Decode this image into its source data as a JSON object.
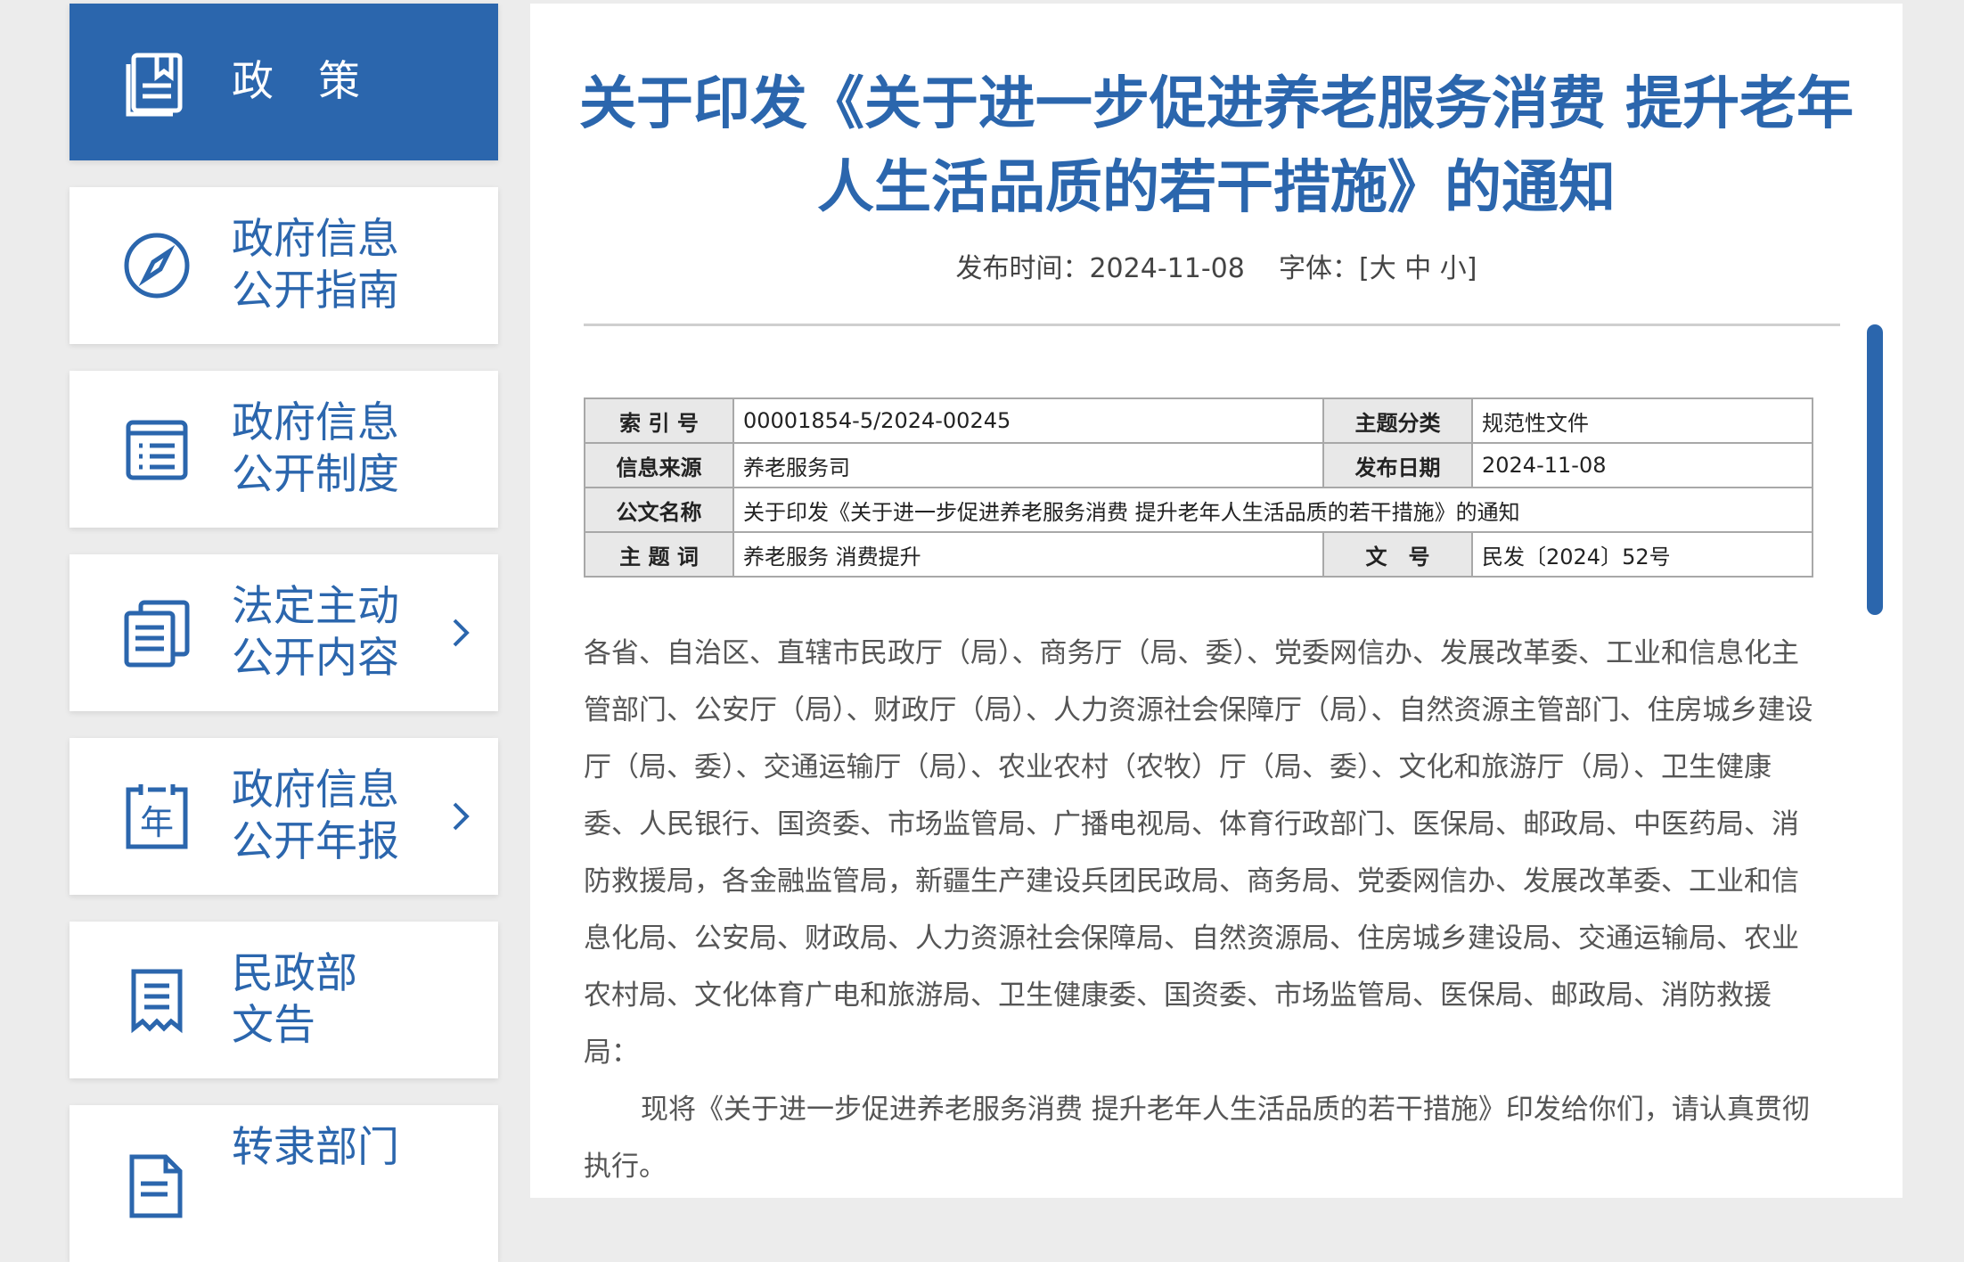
{
  "sidebar": {
    "items": [
      {
        "label_lines": [
          "政策"
        ],
        "icon": "policy-document-icon",
        "active": true,
        "has_arrow": false
      },
      {
        "label_lines": [
          "政府信息",
          "公开指南"
        ],
        "icon": "compass-icon",
        "active": false,
        "has_arrow": false
      },
      {
        "label_lines": [
          "政府信息",
          "公开制度"
        ],
        "icon": "list-document-icon",
        "active": false,
        "has_arrow": false
      },
      {
        "label_lines": [
          "法定主动",
          "公开内容"
        ],
        "icon": "documents-icon",
        "active": false,
        "has_arrow": true
      },
      {
        "label_lines": [
          "政府信息",
          "公开年报"
        ],
        "icon": "annual-report-calendar-icon",
        "active": false,
        "has_arrow": true
      },
      {
        "label_lines": [
          "民政部",
          "文告"
        ],
        "icon": "announcement-icon",
        "active": false,
        "has_arrow": false
      },
      {
        "label_lines": [
          "转隶部门"
        ],
        "icon": "transfer-document-icon",
        "active": false,
        "has_arrow": false
      }
    ]
  },
  "article": {
    "title_lines": [
      "关于印发《关于进一步促进养老服务消费 提升老年",
      "人生活品质的若干措施》的通知"
    ],
    "meta": {
      "date_label": "发布时间：",
      "date": "2024-11-08",
      "font_label": "字体：",
      "font_open": "[",
      "font_large": "大",
      "font_medium": "中",
      "font_small": "小",
      "font_close": "]"
    },
    "info_table": {
      "index_label": "索 引 号",
      "index_value": "00001854-5/2024-00245",
      "category_label": "主题分类",
      "category_value": "规范性文件",
      "source_label": "信息来源",
      "source_value": "养老服务司",
      "pubdate_label": "发布日期",
      "pubdate_value": "2024-11-08",
      "docname_label": "公文名称",
      "docname_value": "关于印发《关于进一步促进养老服务消费 提升老年人生活品质的若干措施》的通知",
      "keywords_label": "主 题 词",
      "keywords_value": "养老服务 消费提升",
      "docno_label": "文　号",
      "docno_value": "民发〔2024〕52号"
    },
    "body": {
      "addressees": "各省、自治区、直辖市民政厅（局）、商务厅（局、委）、党委网信办、发展改革委、工业和信息化主管部门、公安厅（局）、财政厅（局）、人力资源社会保障厅（局）、自然资源主管部门、住房城乡建设厅（局、委）、交通运输厅（局）、农业农村（农牧）厅（局、委）、文化和旅游厅（局）、卫生健康委、人民银行、国资委、市场监管局、广播电视局、体育行政部门、医保局、邮政局、中医药局、消防救援局，各金融监管局，新疆生产建设兵团民政局、商务局、党委网信办、发展改革委、工业和信息化局、公安局、财政局、人力资源社会保障局、自然资源局、住房城乡建设局、交通运输局、农业农村局、文化体育广电和旅游局、卫生健康委、国资委、市场监管局、医保局、邮政局、消防救援局：",
      "paragraph1": "现将《关于进一步促进养老服务消费 提升老年人生活品质的若干措施》印发给你们，请认真贯彻执行。"
    }
  },
  "colors": {
    "brand_blue": "#2b66ad",
    "table_label_bg": "#e8e8e8"
  }
}
